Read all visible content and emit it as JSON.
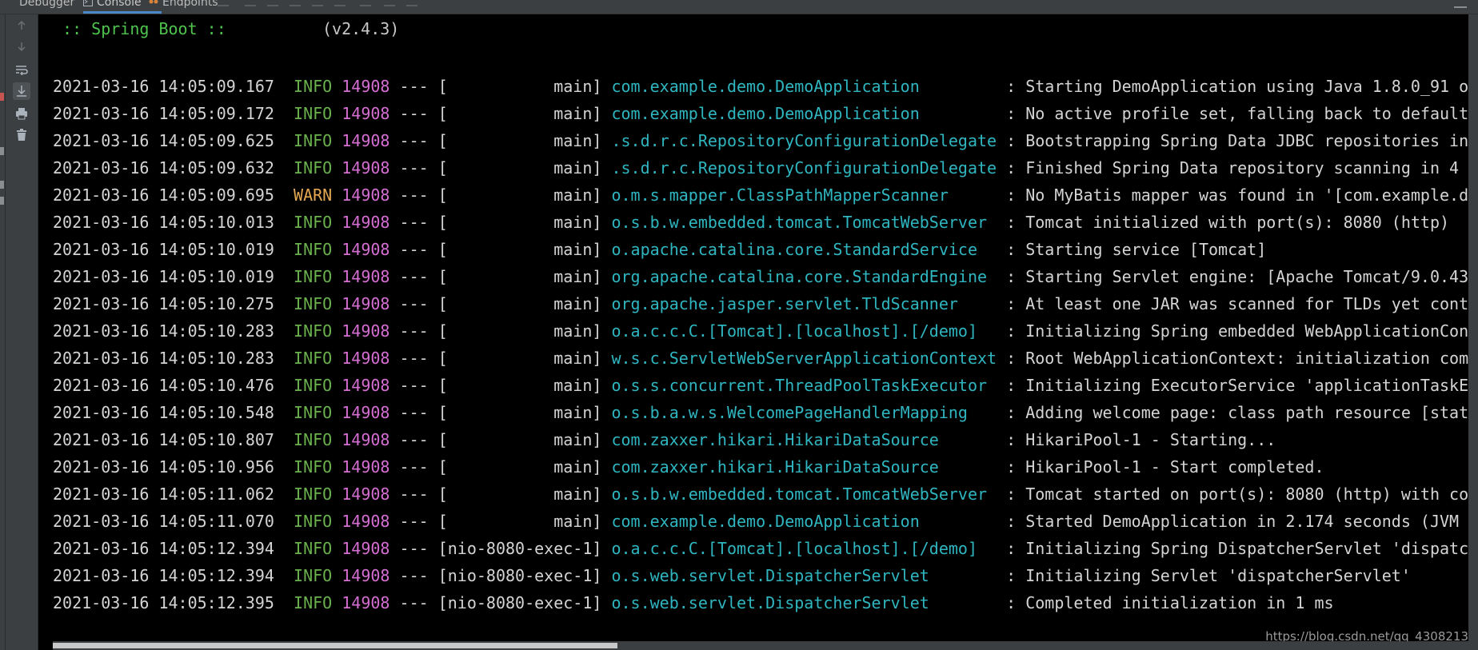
{
  "tabs": [
    {
      "label": "Debugger",
      "active": false
    },
    {
      "label": "Console",
      "active": true
    },
    {
      "label": "Endpoints",
      "active": false
    }
  ],
  "toolbar": [
    {
      "icon": "up-arrow-icon"
    },
    {
      "icon": "down-arrow-icon"
    },
    {
      "icon": "soft-wrap-icon"
    },
    {
      "icon": "scroll-to-end-icon"
    },
    {
      "icon": "print-icon"
    },
    {
      "icon": "trash-icon"
    }
  ],
  "console": {
    "banner_label": " :: Spring Boot ::",
    "banner_version": "(v2.4.3)",
    "lines": [
      {
        "ts": "2021-03-16 14:05:09.167",
        "level": "INFO",
        "pid": "14908",
        "thread": "[           main]",
        "logger": "com.example.demo.DemoApplication        ",
        "msg": " : Starting DemoApplication using Java 1.8.0_91 o"
      },
      {
        "ts": "2021-03-16 14:05:09.172",
        "level": "INFO",
        "pid": "14908",
        "thread": "[           main]",
        "logger": "com.example.demo.DemoApplication        ",
        "msg": " : No active profile set, falling back to default"
      },
      {
        "ts": "2021-03-16 14:05:09.625",
        "level": "INFO",
        "pid": "14908",
        "thread": "[           main]",
        "logger": ".s.d.r.c.RepositoryConfigurationDelegate",
        "msg": " : Bootstrapping Spring Data JDBC repositories in"
      },
      {
        "ts": "2021-03-16 14:05:09.632",
        "level": "INFO",
        "pid": "14908",
        "thread": "[           main]",
        "logger": ".s.d.r.c.RepositoryConfigurationDelegate",
        "msg": " : Finished Spring Data repository scanning in 4"
      },
      {
        "ts": "2021-03-16 14:05:09.695",
        "level": "WARN",
        "pid": "14908",
        "thread": "[           main]",
        "logger": "o.m.s.mapper.ClassPathMapperScanner     ",
        "msg": " : No MyBatis mapper was found in '[com.example.d"
      },
      {
        "ts": "2021-03-16 14:05:10.013",
        "level": "INFO",
        "pid": "14908",
        "thread": "[           main]",
        "logger": "o.s.b.w.embedded.tomcat.TomcatWebServer ",
        "msg": " : Tomcat initialized with port(s): 8080 (http)"
      },
      {
        "ts": "2021-03-16 14:05:10.019",
        "level": "INFO",
        "pid": "14908",
        "thread": "[           main]",
        "logger": "o.apache.catalina.core.StandardService  ",
        "msg": " : Starting service [Tomcat]"
      },
      {
        "ts": "2021-03-16 14:05:10.019",
        "level": "INFO",
        "pid": "14908",
        "thread": "[           main]",
        "logger": "org.apache.catalina.core.StandardEngine ",
        "msg": " : Starting Servlet engine: [Apache Tomcat/9.0.43"
      },
      {
        "ts": "2021-03-16 14:05:10.275",
        "level": "INFO",
        "pid": "14908",
        "thread": "[           main]",
        "logger": "org.apache.jasper.servlet.TldScanner    ",
        "msg": " : At least one JAR was scanned for TLDs yet cont"
      },
      {
        "ts": "2021-03-16 14:05:10.283",
        "level": "INFO",
        "pid": "14908",
        "thread": "[           main]",
        "logger": "o.a.c.c.C.[Tomcat].[localhost].[/demo]  ",
        "msg": " : Initializing Spring embedded WebApplicationCon"
      },
      {
        "ts": "2021-03-16 14:05:10.283",
        "level": "INFO",
        "pid": "14908",
        "thread": "[           main]",
        "logger": "w.s.c.ServletWebServerApplicationContext",
        "msg": " : Root WebApplicationContext: initialization com"
      },
      {
        "ts": "2021-03-16 14:05:10.476",
        "level": "INFO",
        "pid": "14908",
        "thread": "[           main]",
        "logger": "o.s.s.concurrent.ThreadPoolTaskExecutor ",
        "msg": " : Initializing ExecutorService 'applicationTaskE"
      },
      {
        "ts": "2021-03-16 14:05:10.548",
        "level": "INFO",
        "pid": "14908",
        "thread": "[           main]",
        "logger": "o.s.b.a.w.s.WelcomePageHandlerMapping   ",
        "msg": " : Adding welcome page: class path resource [stat"
      },
      {
        "ts": "2021-03-16 14:05:10.807",
        "level": "INFO",
        "pid": "14908",
        "thread": "[           main]",
        "logger": "com.zaxxer.hikari.HikariDataSource      ",
        "msg": " : HikariPool-1 - Starting..."
      },
      {
        "ts": "2021-03-16 14:05:10.956",
        "level": "INFO",
        "pid": "14908",
        "thread": "[           main]",
        "logger": "com.zaxxer.hikari.HikariDataSource      ",
        "msg": " : HikariPool-1 - Start completed."
      },
      {
        "ts": "2021-03-16 14:05:11.062",
        "level": "INFO",
        "pid": "14908",
        "thread": "[           main]",
        "logger": "o.s.b.w.embedded.tomcat.TomcatWebServer ",
        "msg": " : Tomcat started on port(s): 8080 (http) with co"
      },
      {
        "ts": "2021-03-16 14:05:11.070",
        "level": "INFO",
        "pid": "14908",
        "thread": "[           main]",
        "logger": "com.example.demo.DemoApplication        ",
        "msg": " : Started DemoApplication in 2.174 seconds (JVM"
      },
      {
        "ts": "2021-03-16 14:05:12.394",
        "level": "INFO",
        "pid": "14908",
        "thread": "[nio-8080-exec-1]",
        "logger": "o.a.c.c.C.[Tomcat].[localhost].[/demo]  ",
        "msg": " : Initializing Spring DispatcherServlet 'dispatc"
      },
      {
        "ts": "2021-03-16 14:05:12.394",
        "level": "INFO",
        "pid": "14908",
        "thread": "[nio-8080-exec-1]",
        "logger": "o.s.web.servlet.DispatcherServlet       ",
        "msg": " : Initializing Servlet 'dispatcherServlet'"
      },
      {
        "ts": "2021-03-16 14:05:12.395",
        "level": "INFO",
        "pid": "14908",
        "thread": "[nio-8080-exec-1]",
        "logger": "o.s.web.servlet.DispatcherServlet       ",
        "msg": " : Completed initialization in 1 ms"
      }
    ]
  },
  "watermark": "https://blog.csdn.net/qq_4308213",
  "colors": {
    "console_bg": "#000000",
    "info": "#6ab04c",
    "warn": "#e4a852",
    "pid": "#d56ed3",
    "logger": "#2fb6c0",
    "banner": "#4ec34e"
  }
}
